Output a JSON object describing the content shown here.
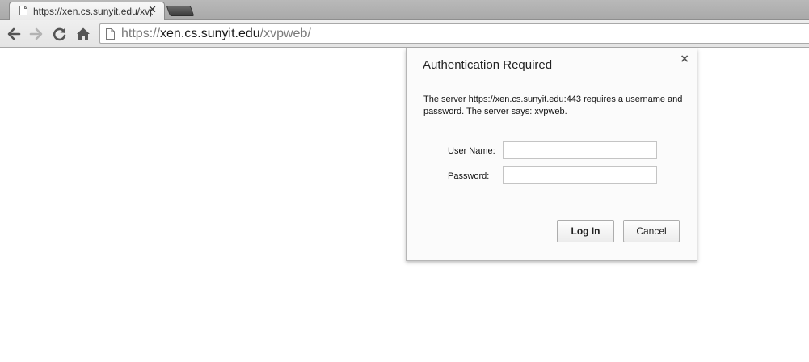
{
  "tab": {
    "title": "https://xen.cs.sunyit.edu/xvpweb/",
    "close_symbol": "✕",
    "icon": "page-icon"
  },
  "toolbar": {
    "back_icon": "arrow-left-icon",
    "forward_icon": "arrow-right-icon",
    "reload_icon": "reload-icon",
    "home_icon": "home-icon"
  },
  "omnibox": {
    "scheme": "https://",
    "host": "xen.cs.sunyit.edu",
    "path": "/xvpweb/"
  },
  "dialog": {
    "title": "Authentication Required",
    "close_symbol": "×",
    "message": "The server https://xen.cs.sunyit.edu:443 requires a username and password. The server says: xvpweb.",
    "username_label": "User Name:",
    "username_value": "",
    "password_label": "Password:",
    "password_value": "",
    "login_label": "Log In",
    "cancel_label": "Cancel"
  }
}
